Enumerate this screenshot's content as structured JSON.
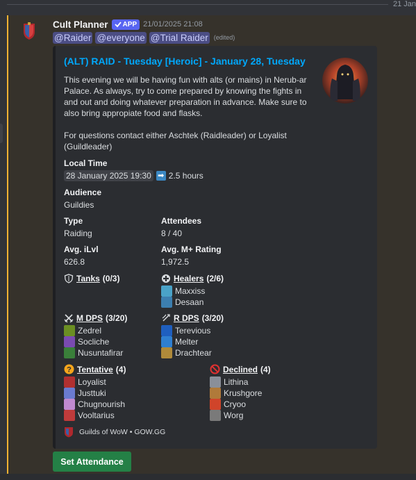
{
  "divider": {
    "date": "21 Jan"
  },
  "message": {
    "author": "Cult Planner",
    "app_badge": "APP",
    "timestamp": "21/01/2025 21:08",
    "mentions": [
      "@Raider",
      "@everyone",
      "@Trial Raider"
    ],
    "edited": "(edited)"
  },
  "embed": {
    "title": "(ALT) RAID - Tuesday [Heroic] - January 28, Tuesday",
    "description": "This evening we will be having fun with alts (or mains) in Nerub-ar Palace. As always, try to come prepared by knowing the fights in and out and doing whatever preparation in advance. Make sure to also bring appropiate food and flasks.\n\nFor questions contact either Aschtek (Raidleader) or Loyalist (Guildleader)",
    "local_time": {
      "name": "Local Time",
      "date": "28 January 2025 19:30",
      "arrow": "➡",
      "duration": "2.5 hours"
    },
    "audience": {
      "name": "Audience",
      "value": "Guildies"
    },
    "type": {
      "name": "Type",
      "value": "Raiding"
    },
    "attendees": {
      "name": "Attendees",
      "value": "8 / 40"
    },
    "ilvl": {
      "name": "Avg. iLvl",
      "value": "626.8"
    },
    "mplus": {
      "name": "Avg. M+ Rating",
      "value": "1,972.5"
    },
    "tanks": {
      "label": "Tanks",
      "count": "(0/3)",
      "icon": "shield-icon"
    },
    "healers": {
      "label": "Healers",
      "count": "(2/6)",
      "icon": "cross-icon",
      "members": [
        {
          "name": "Maxxiss",
          "color": "#4aa3c8"
        },
        {
          "name": "Desaan",
          "color": "#3c7fb0"
        }
      ]
    },
    "mdps": {
      "label": "M DPS",
      "count": "(3/20)",
      "icon": "crossed-swords-icon",
      "members": [
        {
          "name": "Zedrel",
          "color": "#6b8e23"
        },
        {
          "name": "Socliche",
          "color": "#7a4bb0"
        },
        {
          "name": "Nusuntafirar",
          "color": "#3a7f3a"
        }
      ]
    },
    "rdps": {
      "label": "R DPS",
      "count": "(3/20)",
      "icon": "bow-icon",
      "members": [
        {
          "name": "Terevious",
          "color": "#1f5fbf"
        },
        {
          "name": "Melter",
          "color": "#2f7fd0"
        },
        {
          "name": "Drachtear",
          "color": "#b08a3a"
        }
      ]
    },
    "tentative": {
      "label": "Tentative",
      "count": "(4)",
      "icon": "question-icon",
      "members": [
        {
          "name": "Loyalist",
          "color": "#b03030"
        },
        {
          "name": "Justtuki",
          "color": "#6a7bd0"
        },
        {
          "name": "Chugnourish",
          "color": "#c08ad0"
        },
        {
          "name": "Vooltarius",
          "color": "#c03b3b"
        }
      ]
    },
    "declined": {
      "label": "Declined",
      "count": "(4)",
      "icon": "no-entry-icon",
      "members": [
        {
          "name": "Lithina",
          "color": "#8a8f99"
        },
        {
          "name": "Krushgore",
          "color": "#b07a3a"
        },
        {
          "name": "Cryoo",
          "color": "#d0442a"
        },
        {
          "name": "Worg",
          "color": "#7a7a7a"
        }
      ]
    },
    "footer": "Guilds of WoW • GOW.GG"
  },
  "button": {
    "label": "Set Attendance"
  }
}
